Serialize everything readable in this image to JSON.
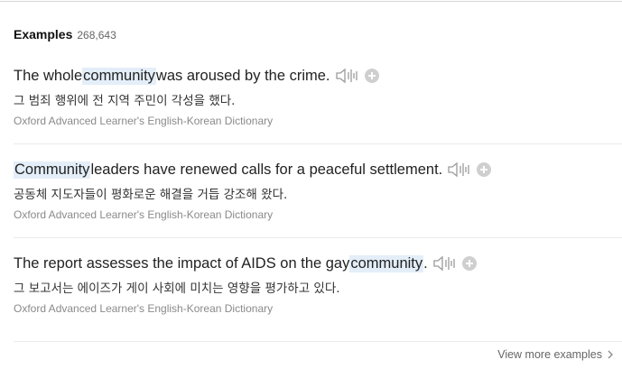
{
  "header": {
    "title": "Examples",
    "count": "268,643"
  },
  "examples": [
    {
      "before": "The whole ",
      "highlight": "community",
      "after": " was aroused by the crime.",
      "translation": "그 범죄 행위에 전 지역 주민이 각성을 했다.",
      "source": "Oxford Advanced Learner's English-Korean Dictionary"
    },
    {
      "before": "",
      "highlight": "Community",
      "after": " leaders have renewed calls for a peaceful settlement.",
      "translation": "공동체 지도자들이 평화로운 해결을 거듭 강조해 왔다.",
      "source": "Oxford Advanced Learner's English-Korean Dictionary"
    },
    {
      "before": "The report assesses the impact of AIDS on the gay ",
      "highlight": "community",
      "after": ".",
      "translation": "그 보고서는 에이즈가 게이 사회에 미치는 영향을 평가하고 있다.",
      "source": "Oxford Advanced Learner's English-Korean Dictionary"
    }
  ],
  "footer": {
    "more_label": "View more examples"
  },
  "colors": {
    "highlight": "#e3eef8",
    "icon": "#9a9a9a",
    "source_text": "#8a8a8a"
  },
  "icons": {
    "play": "speaker-icon",
    "add": "plus-circle-icon",
    "more": "chevron-right-icon"
  }
}
